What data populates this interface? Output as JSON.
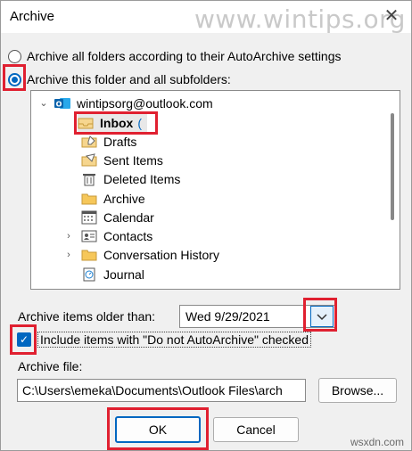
{
  "window": {
    "title": "Archive",
    "close_glyph": "✕"
  },
  "watermark": "www.wintips.org",
  "options": {
    "radio_all": "Archive all folders according to their AutoArchive settings",
    "radio_folder": "Archive this folder and all subfolders:"
  },
  "tree": {
    "account": "wintipsorg@outlook.com",
    "items": [
      {
        "label": "Inbox",
        "icon": "inbox-icon",
        "selected": true,
        "count": "("
      },
      {
        "label": "Drafts",
        "icon": "drafts-icon"
      },
      {
        "label": "Sent Items",
        "icon": "sent-items-icon"
      },
      {
        "label": "Deleted Items",
        "icon": "deleted-items-icon"
      },
      {
        "label": "Archive",
        "icon": "folder-icon"
      },
      {
        "label": "Calendar",
        "icon": "calendar-icon"
      },
      {
        "label": "Contacts",
        "icon": "contacts-icon",
        "expander": "›"
      },
      {
        "label": "Conversation History",
        "icon": "folder-icon",
        "expander": "›"
      },
      {
        "label": "Journal",
        "icon": "journal-icon"
      }
    ]
  },
  "older_than": {
    "label": "Archive items older than:",
    "value": "Wed 9/29/2021"
  },
  "include": {
    "label": "Include items with \"Do not AutoArchive\" checked",
    "checked": true
  },
  "file": {
    "label": "Archive file:",
    "value": "C:\\Users\\emeka\\Documents\\Outlook Files\\arch",
    "browse": "Browse..."
  },
  "buttons": {
    "ok": "OK",
    "cancel": "Cancel"
  },
  "footer_watermark": "wsxdn.com",
  "colors": {
    "accent": "#0067c0",
    "highlight": "#e02030"
  }
}
